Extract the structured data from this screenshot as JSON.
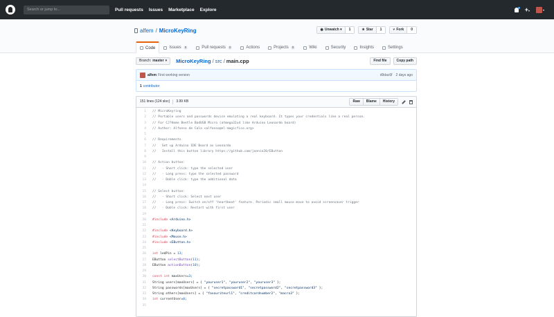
{
  "header": {
    "search_placeholder": "Search or jump to...",
    "nav": [
      "Pull requests",
      "Issues",
      "Marketplace",
      "Explore"
    ]
  },
  "repo": {
    "owner": "alfem",
    "separator": "/",
    "name": "MicroKeyRing",
    "actions": {
      "watch_label": "Unwatch ▾",
      "watch_count": "1",
      "star_label": "Star",
      "star_count": "1",
      "fork_label": "Fork",
      "fork_count": "0"
    },
    "tabs": [
      {
        "label": "Code",
        "count": ""
      },
      {
        "label": "Issues",
        "count": "0"
      },
      {
        "label": "Pull requests",
        "count": "0"
      },
      {
        "label": "Actions",
        "count": ""
      },
      {
        "label": "Projects",
        "count": "0"
      },
      {
        "label": "Wiki",
        "count": ""
      },
      {
        "label": "Security",
        "count": ""
      },
      {
        "label": "Insights",
        "count": ""
      },
      {
        "label": "Settings",
        "count": ""
      }
    ]
  },
  "filenav": {
    "branch_prefix": "Branch:",
    "branch": "master",
    "crumb_root": "MicroKeyRing",
    "crumb_dir": "src",
    "crumb_file": "main.cpp",
    "find_file": "Find file",
    "copy_path": "Copy path"
  },
  "commit": {
    "author": "alfem",
    "message": "First working version",
    "sha": "d9dac6f",
    "time": "2 days ago",
    "contributors_count": "1",
    "contributors_label": "contributor"
  },
  "file": {
    "lines_info": "151 lines (124 sloc)",
    "size": "3.99 KB",
    "raw": "Raw",
    "blame": "Blame",
    "history": "History"
  },
  "code": [
    "// MicroKeyring",
    "// Portable users and passwords device emulating a real keyboard. It types your credentials like a real person.",
    "// For CJ?Home Beetle BadUSB Micro (atmega32u4 like Arduino Leonardo board)",
    "// Author: Alfonso de Cala <alfonso@el-magicfico.org>",
    "",
    "// Requirements",
    "//   Set up Arduino IDE Board as Leonardo",
    "//   Install this button library https://github.com/jonnie20/EButton",
    "",
    "// Action button:",
    "//   - Short click: type the selected user",
    "//   - Long press: type the selected password",
    "//   - Doble click: type the additional data",
    "",
    "// Select button:",
    "//   - Short click: Select next user",
    "//   - Long press: Switch on/off 'heartbeat' feature. Periodic small mouse move to avoid screensaver trigger",
    "//   - Doble click: Restart with first user",
    "",
    "#include <Arduino.h>",
    "",
    "#include <Keyboard.h>",
    "#include <Mouse.h>",
    "#include <EButton.h>",
    "",
    "int ledPin = 13;",
    "EButton selectButton(11);",
    "EButton actionButton(10);",
    "",
    "const int maxUsers=3;",
    "String users[maxUsers] = { \"youruser1\", \"youruser2\", \"youruser3\" };",
    "String passwords[maxUsers] = { \"secretpassword1\", \"secretpassword2\", \"secretpassword3\" };",
    "String others[maxUsers] = { \"favouriteurl1\", \"creditcardnumber2\", \"macro3\" };",
    "int currentUser=0;",
    ""
  ]
}
